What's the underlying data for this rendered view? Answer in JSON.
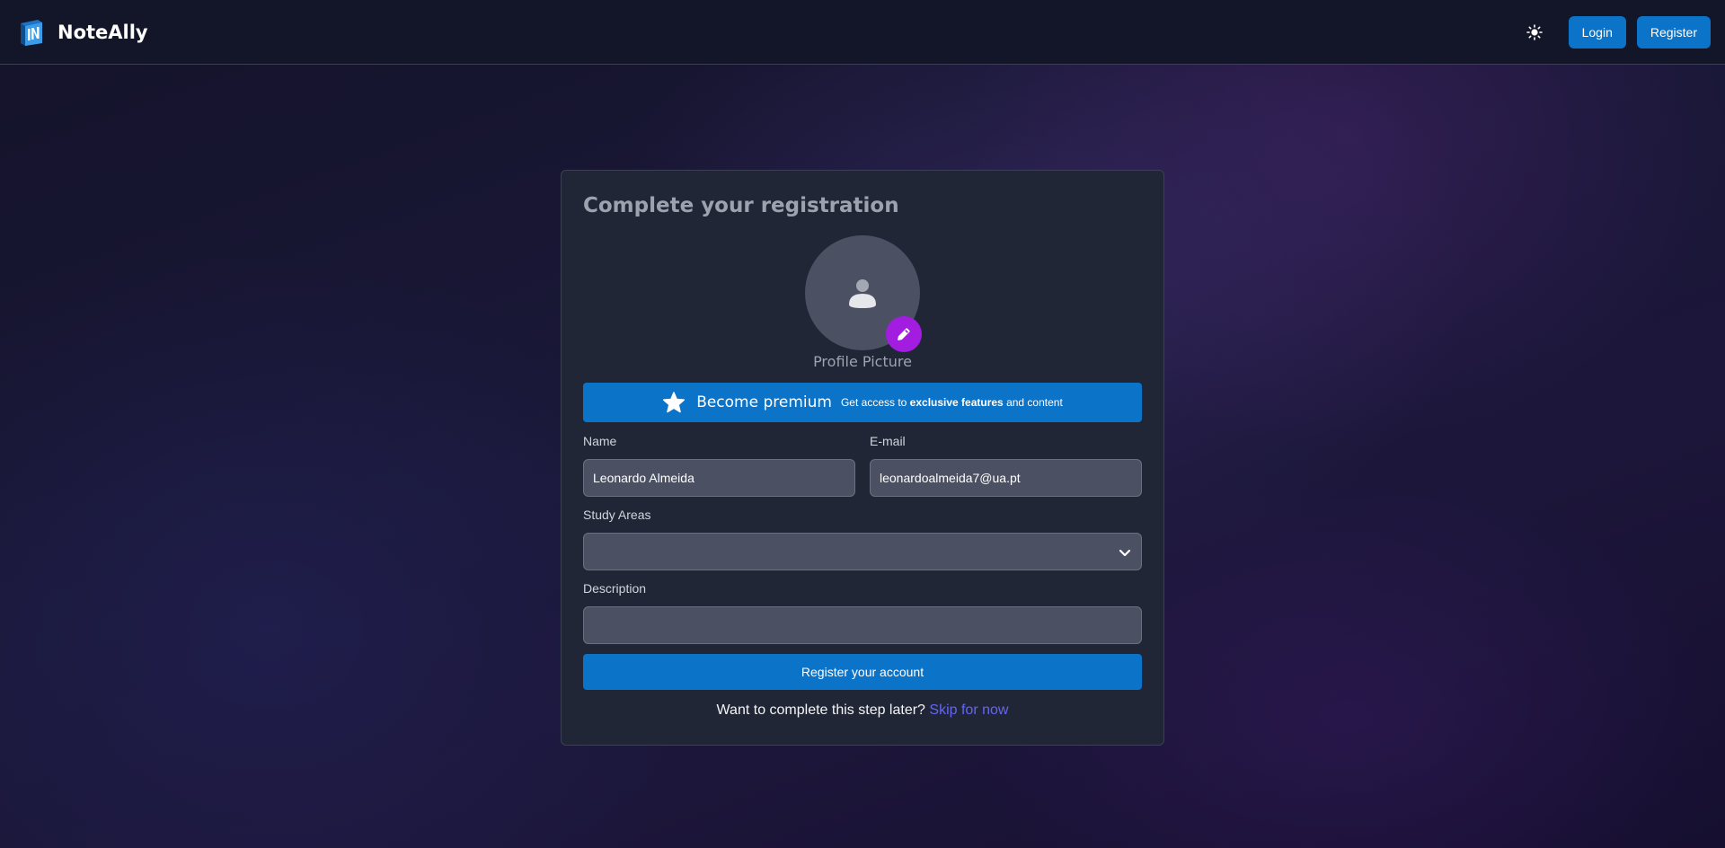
{
  "brand": {
    "name": "NoteAlly",
    "logo_icon": "notebook-logo-icon"
  },
  "navbar": {
    "theme_icon": "sun-icon",
    "login_label": "Login",
    "register_label": "Register"
  },
  "card": {
    "title": "Complete your registration",
    "avatar_icon": "user-icon",
    "edit_icon": "pencil-icon",
    "profile_label": "Profile Picture",
    "premium": {
      "icon": "star-icon",
      "title": "Become premium",
      "sub_prefix": "Get access to ",
      "sub_bold": "exclusive features",
      "sub_suffix": " and content"
    },
    "fields": {
      "name_label": "Name",
      "name_value": "Leonardo Almeida",
      "email_label": "E-mail",
      "email_value": "leonardoalmeida7@ua.pt",
      "study_areas_label": "Study Areas",
      "study_areas_value": "",
      "description_label": "Description",
      "description_value": ""
    },
    "submit_label": "Register your account",
    "later_text": "Want to complete this step later?",
    "skip_label": "Skip for now"
  },
  "colors": {
    "primary": "#0b74c9",
    "edit_badge": "#a21de0",
    "link": "#6366f1",
    "card_bg": "#212637",
    "page_bg": "#16142e"
  }
}
